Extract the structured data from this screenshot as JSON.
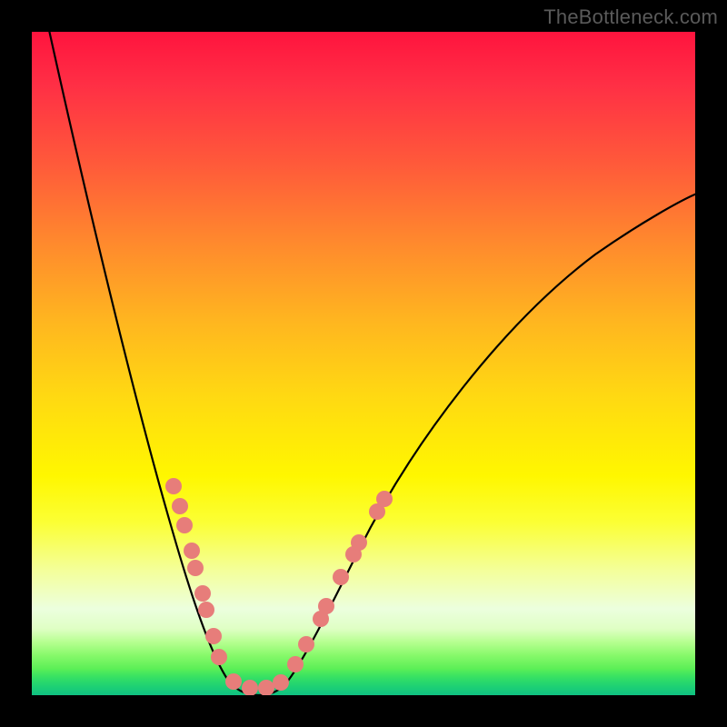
{
  "watermark": "TheBottleneck.com",
  "chart_data": {
    "type": "line",
    "title": "",
    "xlabel": "",
    "ylabel": "",
    "xlim": [
      0,
      100
    ],
    "ylim": [
      0,
      100
    ],
    "background": "vertical-heat-gradient red→orange→yellow→green",
    "series": [
      {
        "name": "bottleneck-curve",
        "x": [
          2,
          10,
          18,
          24,
          28,
          31,
          34,
          36,
          40,
          46,
          54,
          66,
          80,
          92,
          100
        ],
        "y": [
          103,
          70,
          42,
          25,
          12,
          4,
          0,
          2,
          8,
          20,
          36,
          55,
          68,
          74,
          76
        ],
        "note": "V-shaped curve; minimum near x≈34 at y≈0; left arm steeper than right"
      },
      {
        "name": "highlight-dots",
        "color": "#e77d7a",
        "x": [
          21,
          22,
          23,
          24,
          25,
          26,
          26,
          27,
          28,
          30,
          33,
          35,
          38,
          40,
          41,
          44,
          44,
          47,
          48,
          49,
          52,
          53
        ],
        "y": [
          32,
          29,
          26,
          22,
          19,
          15,
          13,
          9,
          6,
          2,
          1,
          1,
          2,
          5,
          8,
          12,
          13,
          18,
          21,
          23,
          28,
          30
        ],
        "note": "salmon markers clustered along lower portion of the V"
      }
    ],
    "annotations": [
      {
        "text": "TheBottleneck.com",
        "position": "top-right",
        "role": "watermark"
      }
    ]
  }
}
